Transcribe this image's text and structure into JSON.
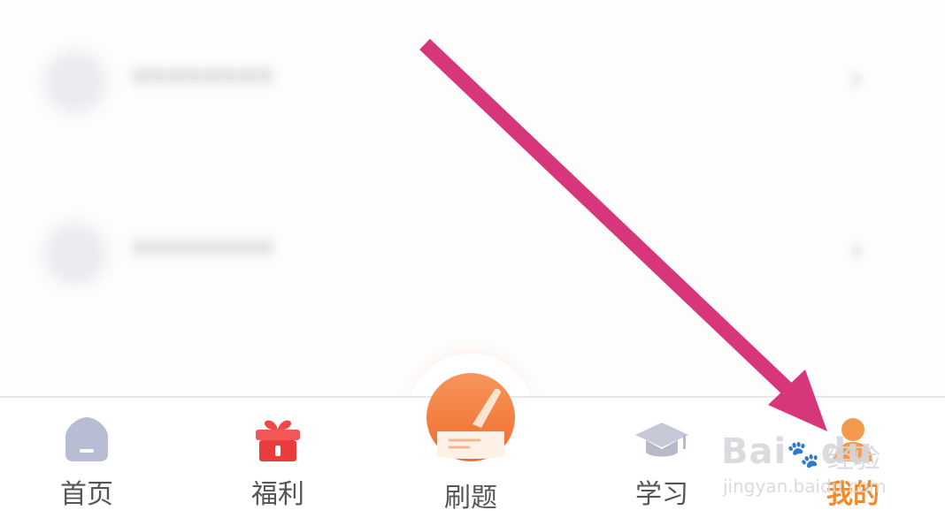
{
  "list": {
    "rows": [
      {
        "label": "********",
        "chevron": "›"
      },
      {
        "label": "********",
        "chevron": "›"
      }
    ]
  },
  "tabbar": {
    "tabs": [
      {
        "label": "首页",
        "icon": "home-icon"
      },
      {
        "label": "福利",
        "icon": "gift-icon"
      },
      {
        "label": "刷题",
        "icon": "pencil-paper-icon"
      },
      {
        "label": "学习",
        "icon": "graduation-cap-icon"
      },
      {
        "label": "我的",
        "icon": "user-icon"
      }
    ],
    "active_color": "#f08a2a",
    "inactive_color": "#555555"
  },
  "annotation": {
    "arrow_color": "#d8367a",
    "points_to": "我的"
  },
  "watermark": {
    "brand_left": "Bai",
    "brand_paw": "🐾",
    "brand_right": "du",
    "product": "经验",
    "url": "jingyan.baidu.com"
  }
}
